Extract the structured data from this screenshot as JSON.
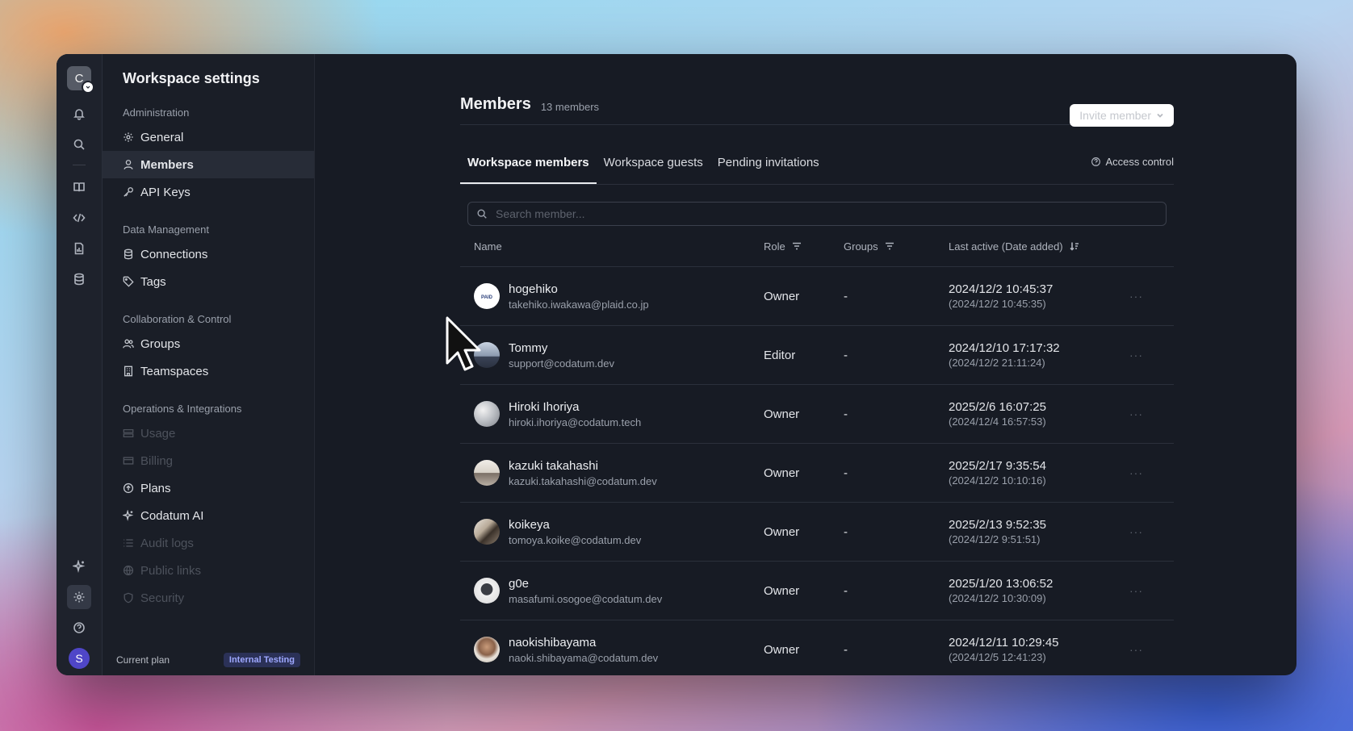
{
  "rail": {
    "workspace_initial": "C",
    "user_initial": "S",
    "icons": [
      "bell-icon",
      "search-icon",
      "book-icon",
      "code-icon",
      "report-icon",
      "database-icon",
      "sparkle-icon",
      "gear-icon",
      "help-icon"
    ]
  },
  "sidebar": {
    "title": "Workspace settings",
    "sections": [
      {
        "label": "Administration"
      },
      {
        "label": "Data Management"
      },
      {
        "label": "Collaboration & Control"
      },
      {
        "label": "Operations & Integrations"
      }
    ],
    "items": {
      "general": "General",
      "members": "Members",
      "api_keys": "API Keys",
      "connections": "Connections",
      "tags": "Tags",
      "groups": "Groups",
      "teamspaces": "Teamspaces",
      "usage": "Usage",
      "billing": "Billing",
      "plans": "Plans",
      "codatum_ai": "Codatum AI",
      "audit_logs": "Audit logs",
      "public_links": "Public links",
      "security": "Security"
    },
    "plan": {
      "label": "Current plan",
      "badge": "Internal Testing"
    }
  },
  "main": {
    "title": "Members",
    "count": "13 members",
    "invite_label": "Invite member",
    "tabs": {
      "workspace_members": "Workspace members",
      "workspace_guests": "Workspace guests",
      "pending_invitations": "Pending invitations"
    },
    "access_control": "Access control",
    "search_placeholder": "Search member...",
    "columns": {
      "name": "Name",
      "role": "Role",
      "groups": "Groups",
      "last_active": "Last active (Date added)"
    },
    "members": [
      {
        "name": "hogehiko",
        "email": "takehiko.iwakawa@plaid.co.jp",
        "role": "Owner",
        "groups": "-",
        "last_active": "2024/12/2 10:45:37",
        "date_added": "(2024/12/2 10:45:35)",
        "more": "···"
      },
      {
        "name": "Tommy",
        "email": "support@codatum.dev",
        "role": "Editor",
        "groups": "-",
        "last_active": "2024/12/10 17:17:32",
        "date_added": "(2024/12/2 21:11:24)",
        "more": "···"
      },
      {
        "name": "Hiroki Ihoriya",
        "email": "hiroki.ihoriya@codatum.tech",
        "role": "Owner",
        "groups": "-",
        "last_active": "2025/2/6 16:07:25",
        "date_added": "(2024/12/4 16:57:53)",
        "more": "···"
      },
      {
        "name": "kazuki takahashi",
        "email": "kazuki.takahashi@codatum.dev",
        "role": "Owner",
        "groups": "-",
        "last_active": "2025/2/17 9:35:54",
        "date_added": "(2024/12/2 10:10:16)",
        "more": "···"
      },
      {
        "name": "koikeya",
        "email": "tomoya.koike@codatum.dev",
        "role": "Owner",
        "groups": "-",
        "last_active": "2025/2/13 9:52:35",
        "date_added": "(2024/12/2 9:51:51)",
        "more": "···"
      },
      {
        "name": "g0e",
        "email": "masafumi.osogoe@codatum.dev",
        "role": "Owner",
        "groups": "-",
        "last_active": "2025/1/20 13:06:52",
        "date_added": "(2024/12/2 10:30:09)",
        "more": "···"
      },
      {
        "name": "naokishibayama",
        "email": "naoki.shibayama@codatum.dev",
        "role": "Owner",
        "groups": "-",
        "last_active": "2024/12/11 10:29:45",
        "date_added": "(2024/12/5 12:41:23)",
        "more": "···"
      }
    ]
  }
}
